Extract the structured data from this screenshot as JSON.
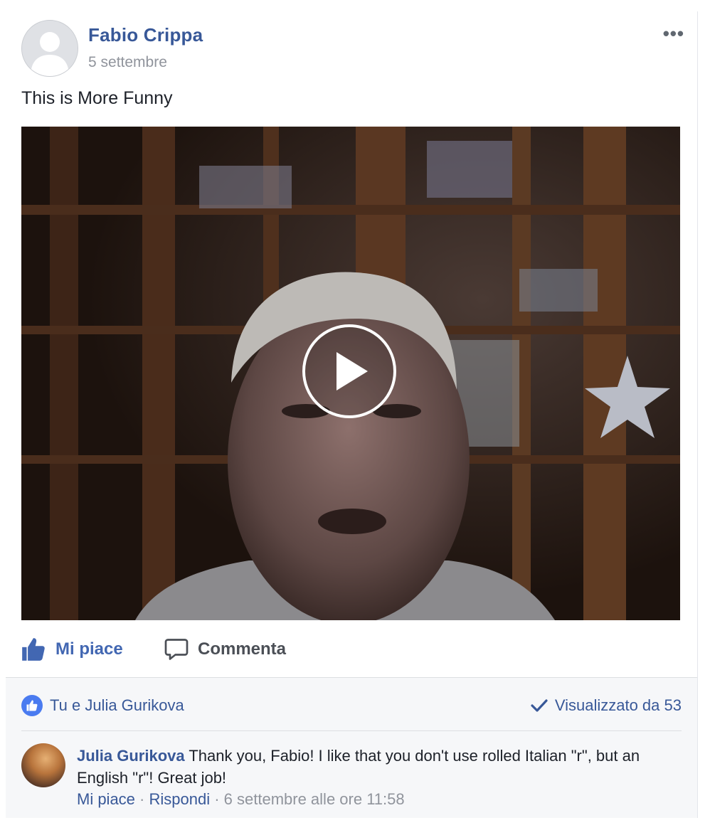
{
  "post": {
    "author": "Fabio Crippa",
    "date": "5 settembre",
    "menu": "•••",
    "text": "This is More Funny"
  },
  "actions": {
    "like_label": "Mi piace",
    "comment_label": "Commenta"
  },
  "summary": {
    "reactions_text": "Tu e Julia Gurikova",
    "views_text": "Visualizzato da 53"
  },
  "comment": {
    "author": "Julia Gurikova",
    "text": "Thank you, Fabio! I like that you don't use rolled Italian \"r\", but an English \"r\"! Great job!",
    "like_label": "Mi piace",
    "separator": " · ",
    "reply_label": "Rispondi",
    "timestamp": "6 settembre alle ore 11:58"
  },
  "colors": {
    "link_blue": "#385898",
    "action_blue": "#4267b2",
    "meta_gray": "#90949c"
  }
}
